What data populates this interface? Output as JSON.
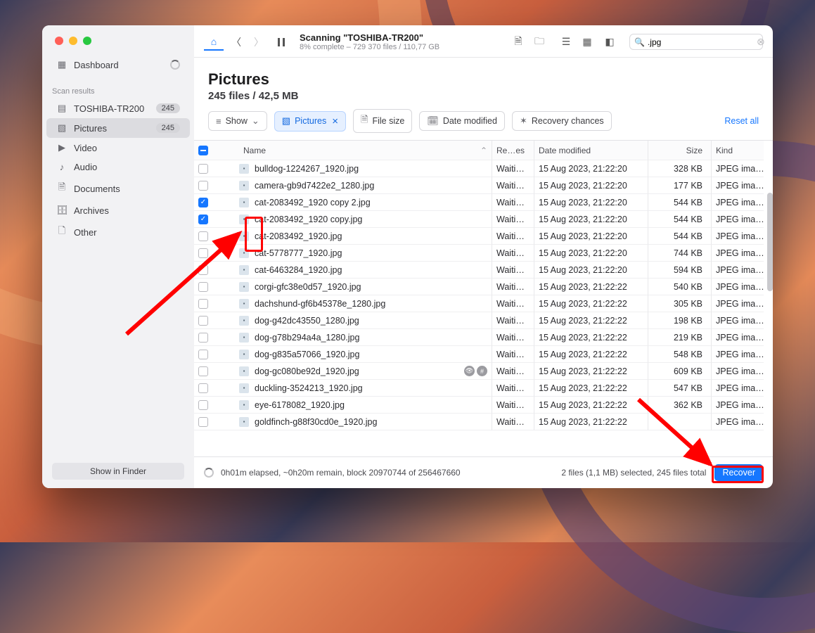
{
  "sidebar": {
    "dashboard": "Dashboard",
    "section_label": "Scan results",
    "items": [
      {
        "icon": "▤",
        "label": "TOSHIBA-TR200",
        "badge": "245"
      },
      {
        "icon": "▧",
        "label": "Pictures",
        "badge": "245",
        "active": true
      },
      {
        "icon": "▶",
        "label": "Video"
      },
      {
        "icon": "♪",
        "label": "Audio"
      },
      {
        "icon": "🗎",
        "label": "Documents"
      },
      {
        "icon": "🗄",
        "label": "Archives"
      },
      {
        "icon": "🗋",
        "label": "Other"
      }
    ],
    "show_finder": "Show in Finder"
  },
  "toolbar": {
    "title": "Scanning \"TOSHIBA-TR200\"",
    "subtitle": "8% complete – 729 370 files / 110,77 GB",
    "search_value": ".jpg"
  },
  "header": {
    "title": "Pictures",
    "subtitle": "245 files / 42,5 MB"
  },
  "filters": {
    "show": "Show",
    "pictures": "Pictures",
    "file_size": "File size",
    "date_modified": "Date modified",
    "recovery": "Recovery chances",
    "reset": "Reset all"
  },
  "columns": {
    "name": "Name",
    "rec": "Re…es",
    "date": "Date modified",
    "size": "Size",
    "kind": "Kind"
  },
  "files": [
    {
      "sel": false,
      "name": "bulldog-1224267_1920.jpg",
      "rec": "Waiti…",
      "date": "15 Aug 2023, 21:22:20",
      "size": "328 KB",
      "kind": "JPEG ima…"
    },
    {
      "sel": false,
      "name": "camera-gb9d7422e2_1280.jpg",
      "rec": "Waiti…",
      "date": "15 Aug 2023, 21:22:20",
      "size": "177 KB",
      "kind": "JPEG ima…"
    },
    {
      "sel": true,
      "name": "cat-2083492_1920 copy 2.jpg",
      "rec": "Waiti…",
      "date": "15 Aug 2023, 21:22:20",
      "size": "544 KB",
      "kind": "JPEG ima…"
    },
    {
      "sel": true,
      "name": "cat-2083492_1920 copy.jpg",
      "rec": "Waiti…",
      "date": "15 Aug 2023, 21:22:20",
      "size": "544 KB",
      "kind": "JPEG ima…"
    },
    {
      "sel": false,
      "name": "cat-2083492_1920.jpg",
      "rec": "Waiti…",
      "date": "15 Aug 2023, 21:22:20",
      "size": "544 KB",
      "kind": "JPEG ima…"
    },
    {
      "sel": false,
      "name": "cat-5778777_1920.jpg",
      "rec": "Waiti…",
      "date": "15 Aug 2023, 21:22:20",
      "size": "744 KB",
      "kind": "JPEG ima…"
    },
    {
      "sel": false,
      "name": "cat-6463284_1920.jpg",
      "rec": "Waiti…",
      "date": "15 Aug 2023, 21:22:20",
      "size": "594 KB",
      "kind": "JPEG ima…"
    },
    {
      "sel": false,
      "name": "corgi-gfc38e0d57_1920.jpg",
      "rec": "Waiti…",
      "date": "15 Aug 2023, 21:22:22",
      "size": "540 KB",
      "kind": "JPEG ima…"
    },
    {
      "sel": false,
      "name": "dachshund-gf6b45378e_1280.jpg",
      "rec": "Waiti…",
      "date": "15 Aug 2023, 21:22:22",
      "size": "305 KB",
      "kind": "JPEG ima…"
    },
    {
      "sel": false,
      "name": "dog-g42dc43550_1280.jpg",
      "rec": "Waiti…",
      "date": "15 Aug 2023, 21:22:22",
      "size": "198 KB",
      "kind": "JPEG ima…"
    },
    {
      "sel": false,
      "name": "dog-g78b294a4a_1280.jpg",
      "rec": "Waiti…",
      "date": "15 Aug 2023, 21:22:22",
      "size": "219 KB",
      "kind": "JPEG ima…"
    },
    {
      "sel": false,
      "name": "dog-g835a57066_1920.jpg",
      "rec": "Waiti…",
      "date": "15 Aug 2023, 21:22:22",
      "size": "548 KB",
      "kind": "JPEG ima…"
    },
    {
      "sel": false,
      "name": "dog-gc080be92d_1920.jpg",
      "flags": true,
      "rec": "Waiti…",
      "date": "15 Aug 2023, 21:22:22",
      "size": "609 KB",
      "kind": "JPEG ima…"
    },
    {
      "sel": false,
      "name": "duckling-3524213_1920.jpg",
      "rec": "Waiti…",
      "date": "15 Aug 2023, 21:22:22",
      "size": "547 KB",
      "kind": "JPEG ima…"
    },
    {
      "sel": false,
      "name": "eye-6178082_1920.jpg",
      "rec": "Waiti…",
      "date": "15 Aug 2023, 21:22:22",
      "size": "362 KB",
      "kind": "JPEG ima…"
    },
    {
      "sel": false,
      "name": "goldfinch-g88f30cd0e_1920.jpg",
      "rec": "Waiti…",
      "date": "15 Aug 2023, 21:22:22",
      "size": "",
      "kind": "JPEG ima…"
    }
  ],
  "status": {
    "elapsed": "0h01m elapsed, ~0h20m remain, block 20970744 of 256467660",
    "selection": "2 files (1,1 MB) selected, 245 files total",
    "recover": "Recover"
  }
}
